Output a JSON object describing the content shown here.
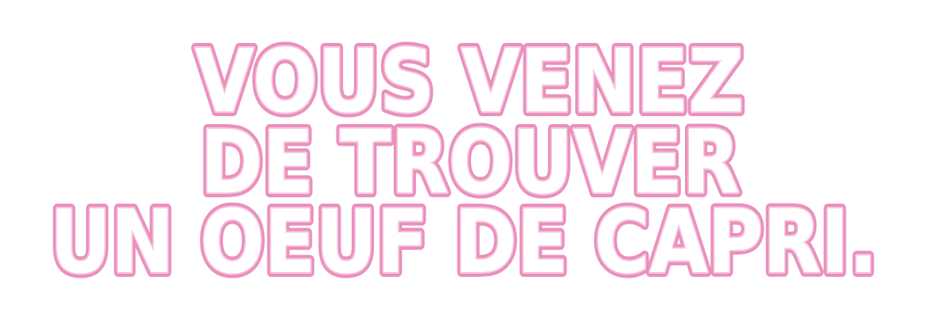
{
  "headline": {
    "line1": "VOUS VENEZ",
    "line2": "DE TROUVER",
    "line3": "UN OEUF DE CAPRI."
  },
  "colors": {
    "outline": "#ea8fbd",
    "inner_outline": "#f7c6de",
    "fill": "#ffffff",
    "background": "#ffffff"
  }
}
